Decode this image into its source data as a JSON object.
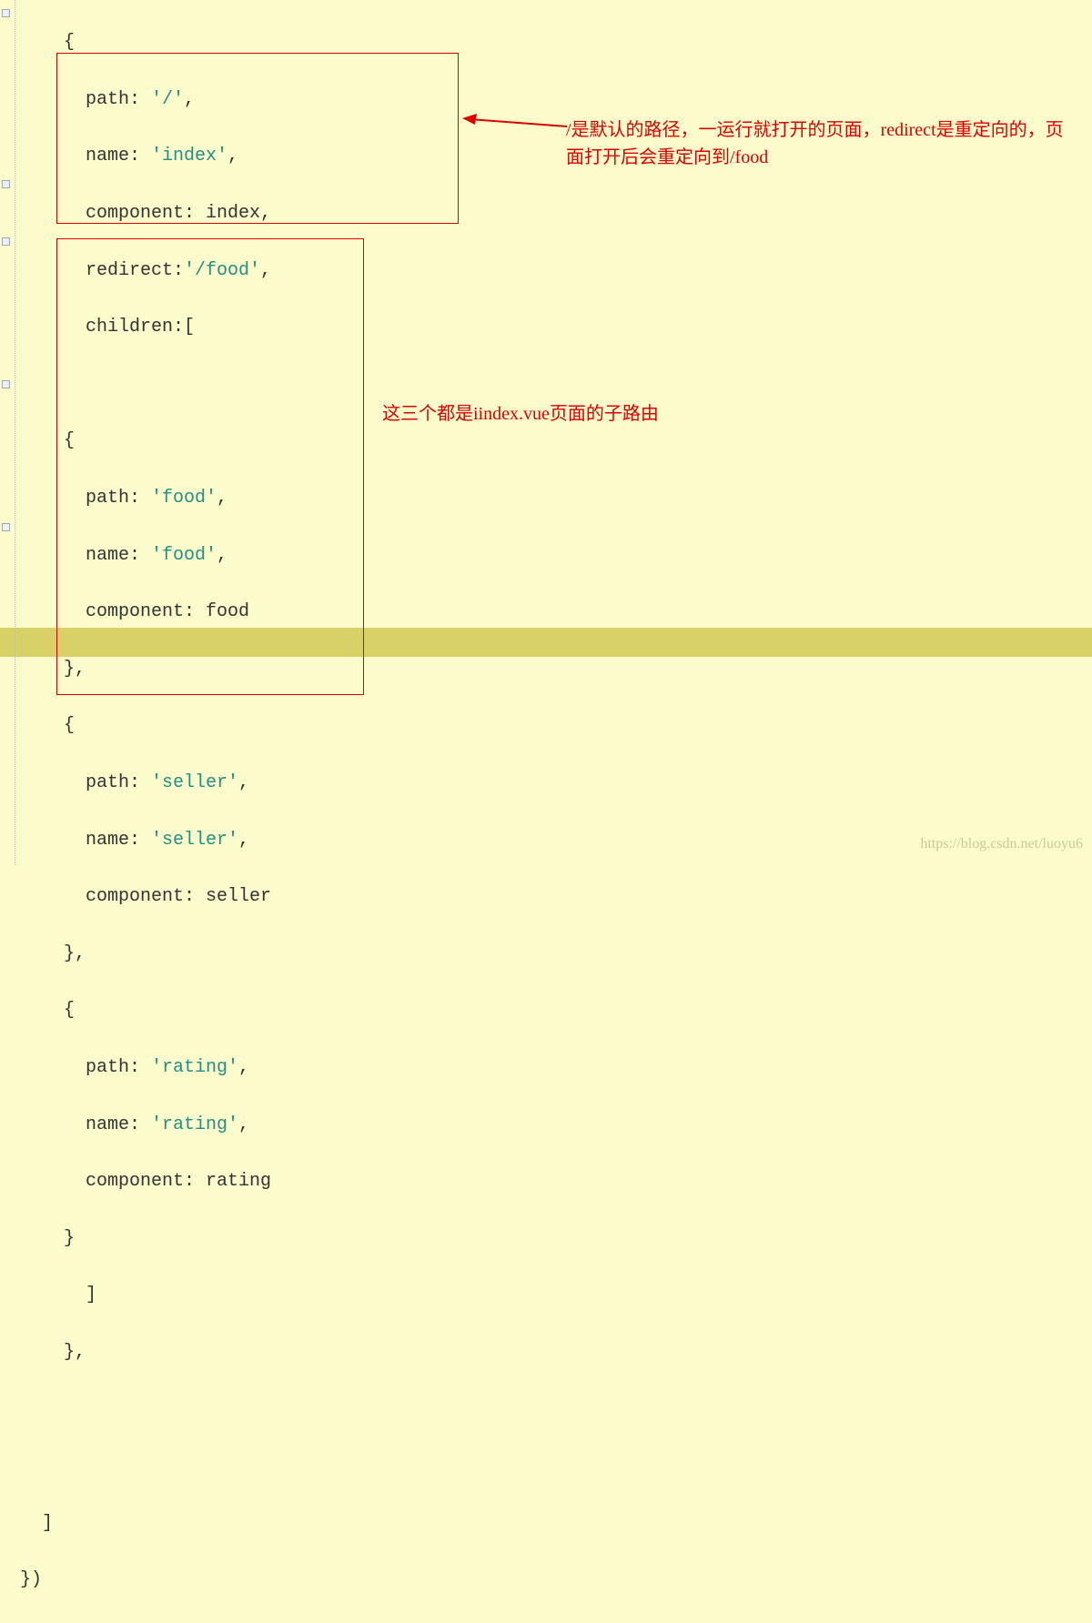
{
  "code": {
    "l1": "    {",
    "l2a": "      path: ",
    "l2b": "'/'",
    "l2c": ",",
    "l3a": "      name: ",
    "l3b": "'index'",
    "l3c": ",",
    "l4": "      component: index,",
    "l5a": "      redirect:",
    "l5b": "'/food'",
    "l5c": ",",
    "l6": "      children:[",
    "l7": "",
    "l8": "    {",
    "l9a": "      path: ",
    "l9b": "'food'",
    "l9c": ",",
    "l10a": "      name: ",
    "l10b": "'food'",
    "l10c": ",",
    "l11": "      component: food",
    "l12": "    },",
    "l13": "    {",
    "l14a": "      path: ",
    "l14b": "'seller'",
    "l14c": ",",
    "l15a": "      name: ",
    "l15b": "'seller'",
    "l15c": ",",
    "l16": "      component: seller",
    "l17": "    },",
    "l18": "    {",
    "l19a": "      path: ",
    "l19b": "'rating'",
    "l19c": ",",
    "l20a": "      name: ",
    "l20b": "'rating'",
    "l20c": ",",
    "l21": "      component: rating",
    "l22": "    }",
    "l23": "      ]",
    "l24": "    },",
    "l25": "",
    "l26": "",
    "l27": "  ]",
    "l28": "})"
  },
  "annotations": {
    "a1": "/是默认的路径，一运行就打开的页面，redirect是重定向的，页面打开后会重定向到/food",
    "a2": "这三个都是iindex.vue页面的子路由"
  },
  "watermark": "https://blog.csdn.net/luoyu6"
}
